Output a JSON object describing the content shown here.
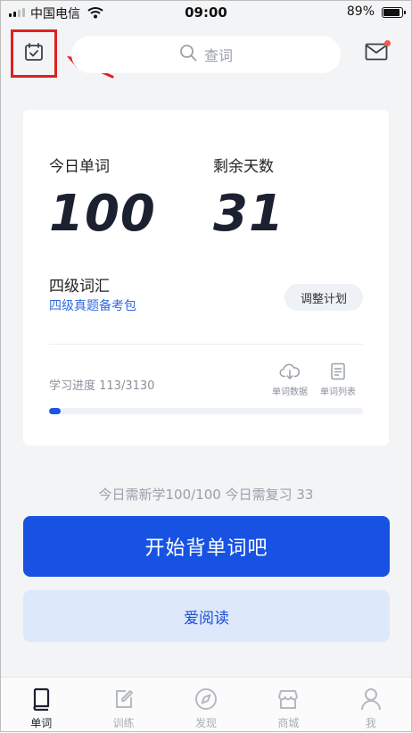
{
  "status_bar": {
    "carrier": "中国电信",
    "time": "09:00",
    "battery": "89%",
    "battery_level": 0.89,
    "icons": [
      "signal-icon",
      "wifi-icon",
      "battery-icon"
    ]
  },
  "header": {
    "calendar_icon": "calendar-check-icon",
    "search_placeholder": "查词",
    "mail_icon": "mail-icon",
    "mail_has_unread": true
  },
  "stats": {
    "today_words_label": "今日单词",
    "today_words_value": "100",
    "remaining_days_label": "剩余天数",
    "remaining_days_value": "31"
  },
  "plan": {
    "book_title": "四级词汇",
    "book_package": "四级真题备考包",
    "adjust_button": "调整计划"
  },
  "progress": {
    "label": "学习进度 113/3130",
    "fraction": 0.036,
    "word_data_label": "单词数据",
    "word_list_label": "单词列表"
  },
  "daily_summary": "今日需新学100/100  今日需复习 33",
  "start_button": "开始背单词吧",
  "read_button": "爱阅读",
  "tabs": [
    {
      "label": "单词",
      "icon": "book-icon",
      "active": true
    },
    {
      "label": "训练",
      "icon": "edit-icon",
      "active": false
    },
    {
      "label": "发现",
      "icon": "compass-icon",
      "active": false
    },
    {
      "label": "商城",
      "icon": "store-icon",
      "active": false
    },
    {
      "label": "我",
      "icon": "user-icon",
      "active": false
    }
  ],
  "colors": {
    "primary": "#1752e3",
    "link": "#2f6ae0",
    "highlight_box": "#e02020",
    "background": "#f3f4f6"
  }
}
